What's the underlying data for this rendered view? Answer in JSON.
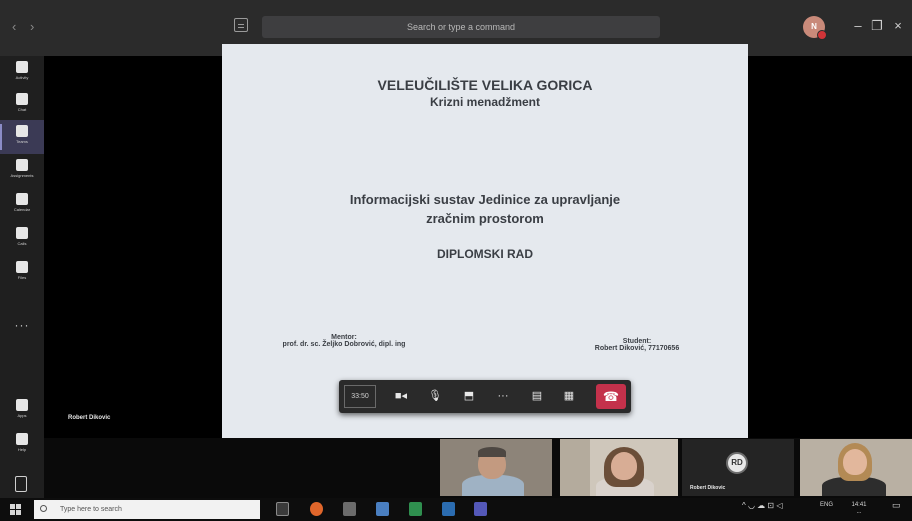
{
  "header": {
    "search_placeholder": "Search or type a command",
    "profile_initials": "N"
  },
  "rail": {
    "items": [
      {
        "label": "Activity"
      },
      {
        "label": "Chat"
      },
      {
        "label": "Teams"
      },
      {
        "label": "Assignments"
      },
      {
        "label": "Calendar"
      },
      {
        "label": "Calls"
      },
      {
        "label": "Files"
      },
      {
        "label": "Apps"
      },
      {
        "label": "Help"
      }
    ],
    "more_label": "···"
  },
  "presenter": {
    "name": "Robert Dikovic"
  },
  "slide": {
    "university": "VELEUČILIŠTE VELIKA GORICA",
    "course": "Krizni menadžment",
    "thesis_line1": "Informacijski sustav Jedinice za upravljanje",
    "thesis_line2": "zračnim prostorom",
    "type": "DIPLOMSKI RAD",
    "mentor_label": "Mentor:",
    "mentor_name": "prof. dr. sc. Željko Dobrović, dipl. ing",
    "student_label": "Student:",
    "student_name": "Robert Diković, 77170656"
  },
  "call": {
    "timer": "33:50",
    "controls": [
      "camera-icon",
      "mic-icon",
      "share-screen-icon",
      "more-icon",
      "chat-icon",
      "participants-icon",
      "hangup-icon"
    ]
  },
  "participants": [
    {
      "name": ""
    },
    {
      "name": ""
    },
    {
      "name": "Robert Dikovic",
      "initials": "RD"
    },
    {
      "name": ""
    }
  ],
  "taskbar": {
    "search_placeholder": "Type here to search",
    "language": "ENG",
    "time": "14:41",
    "date": "..."
  },
  "colors": {
    "rail_active": "#3b3a55",
    "hangup": "#c4314b",
    "slide_bg": "#e5e9ee"
  }
}
